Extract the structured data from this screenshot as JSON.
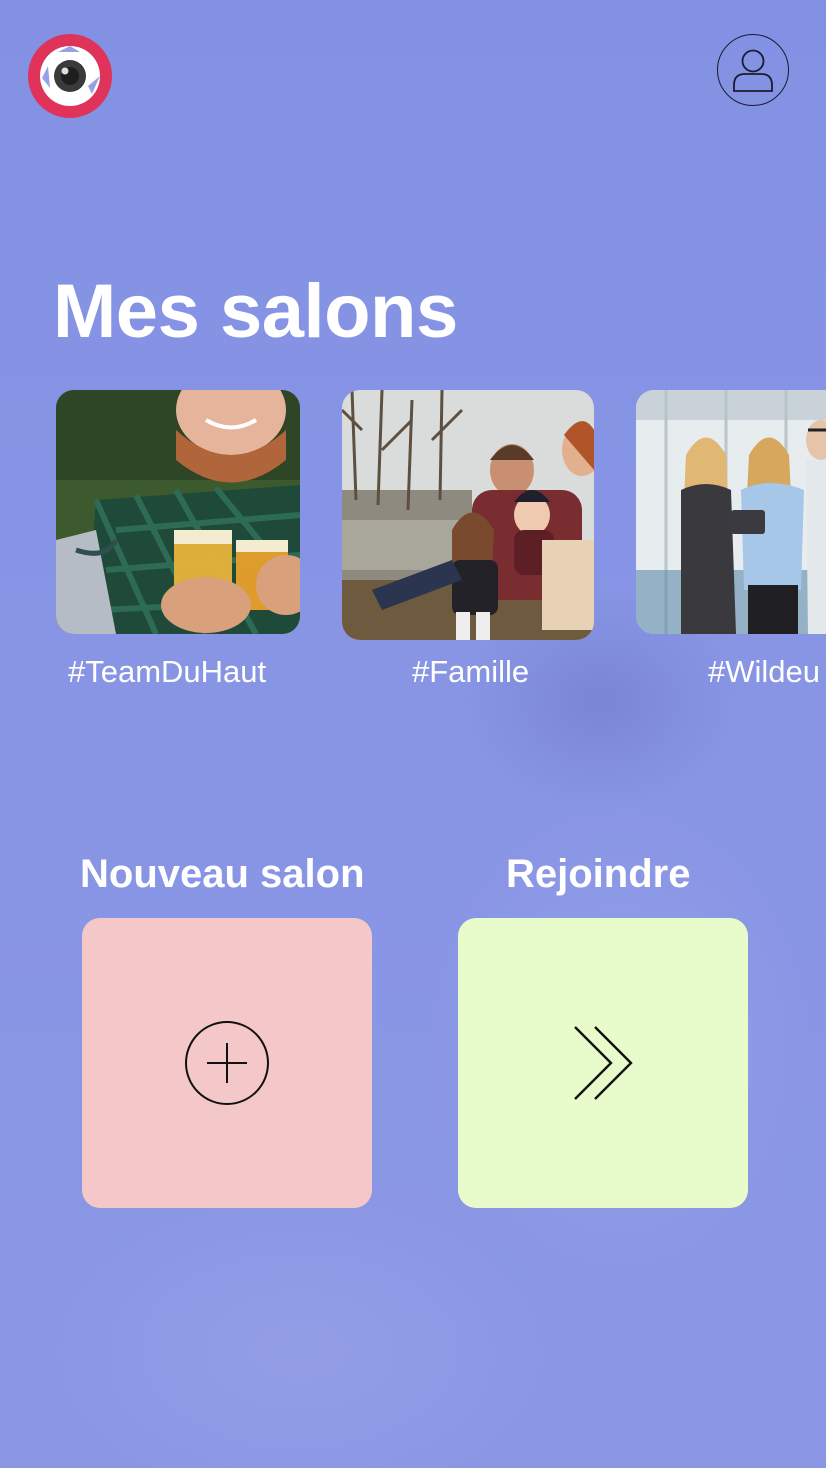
{
  "header": {
    "logo_icon": "camera-eye-logo",
    "profile_icon": "user-icon"
  },
  "page_title": "Mes salons",
  "salons": [
    {
      "label": "#TeamDuHaut",
      "thumbnail": "two-people-toasting-beer"
    },
    {
      "label": "#Famille",
      "thumbnail": "family-by-lake"
    },
    {
      "label": "#Wildeu",
      "thumbnail": "three-colleagues-office"
    }
  ],
  "actions": {
    "new_salon": {
      "title": "Nouveau salon",
      "icon": "plus-circle-icon",
      "color": "#f4c8c8"
    },
    "join": {
      "title": "Rejoindre",
      "icon": "double-chevron-right-icon",
      "color": "#e8fccb"
    }
  },
  "colors": {
    "background": "#8490e2",
    "brand_red": "#e0335a",
    "text": "#ffffff"
  }
}
